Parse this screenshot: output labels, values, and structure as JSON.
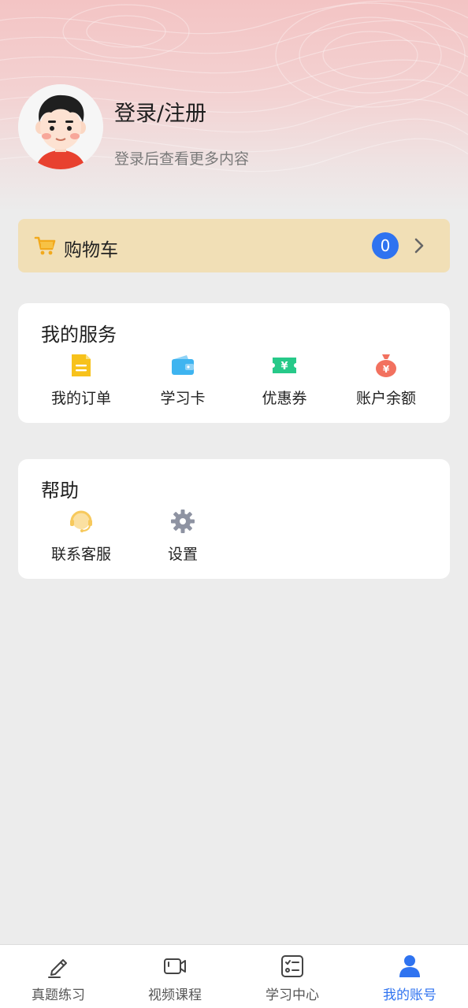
{
  "profile": {
    "login_title": "登录/注册",
    "login_subtitle": "登录后查看更多内容",
    "avatar_icon": "user-avatar"
  },
  "cart": {
    "label": "购物车",
    "count": "0",
    "icon": "cart-icon",
    "count_color": "#2f73f0"
  },
  "services": {
    "title": "我的服务",
    "items": [
      {
        "label": "我的订单",
        "icon": "order-document-icon",
        "color": "#f7c21b"
      },
      {
        "label": "学习卡",
        "icon": "wallet-card-icon",
        "color": "#3eb4f0"
      },
      {
        "label": "优惠券",
        "icon": "coupon-ticket-icon",
        "color": "#27c989"
      },
      {
        "label": "账户余额",
        "icon": "money-bag-icon",
        "color": "#f2715f"
      }
    ]
  },
  "help": {
    "title": "帮助",
    "items": [
      {
        "label": "联系客服",
        "icon": "customer-service-headset-icon",
        "color": "#f7c95c"
      },
      {
        "label": "设置",
        "icon": "settings-gear-icon",
        "color": "#8e93a2"
      }
    ]
  },
  "tabbar": {
    "active_color": "#2f73f0",
    "tabs": [
      {
        "label": "真题练习",
        "icon": "pencil-edit-icon"
      },
      {
        "label": "视频课程",
        "icon": "video-camera-icon"
      },
      {
        "label": "学习中心",
        "icon": "checklist-icon"
      },
      {
        "label": "我的账号",
        "icon": "user-profile-icon",
        "active": true
      }
    ]
  }
}
